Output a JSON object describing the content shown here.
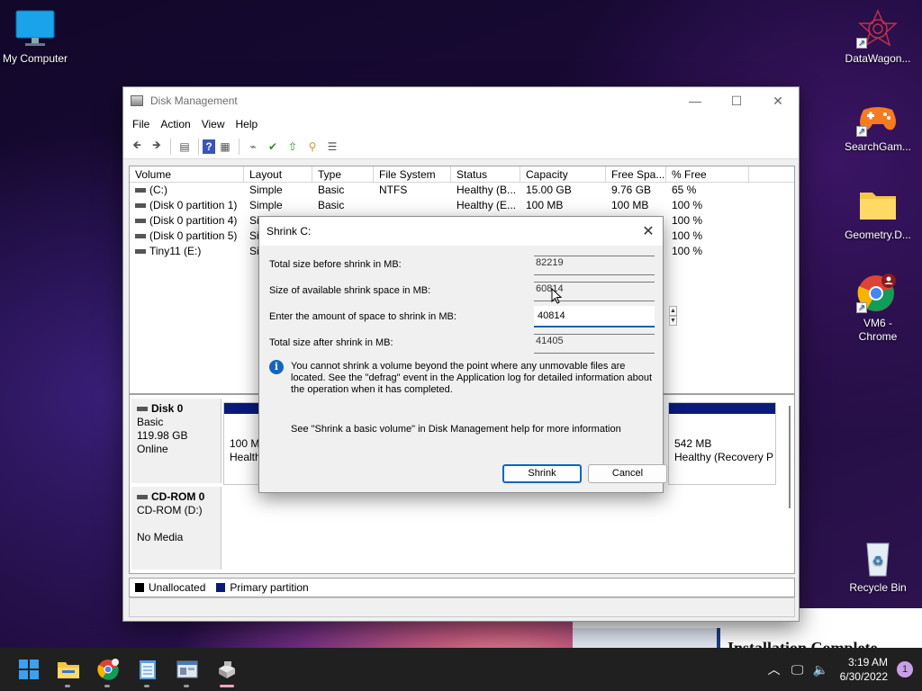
{
  "desktop": {
    "icons": [
      {
        "label": "My Computer"
      },
      {
        "label": "DataWagon..."
      },
      {
        "label": "SearchGam..."
      },
      {
        "label": "Geometry.D..."
      },
      {
        "label": "VM6 -\nChrome"
      },
      {
        "label": "Recycle Bin"
      }
    ]
  },
  "window": {
    "title": "Disk Management",
    "menu": [
      "File",
      "Action",
      "View",
      "Help"
    ],
    "columns": [
      "Volume",
      "Layout",
      "Type",
      "File System",
      "Status",
      "Capacity",
      "Free Spa...",
      "% Free"
    ],
    "volumes": [
      [
        "(C:)",
        "Simple",
        "Basic",
        "NTFS",
        "Healthy (B...",
        "15.00 GB",
        "9.76 GB",
        "65 %"
      ],
      [
        "(Disk 0 partition 1)",
        "Simple",
        "Basic",
        "",
        "Healthy (E...",
        "100 MB",
        "100 MB",
        "100 %"
      ],
      [
        "(Disk 0 partition 4)",
        "Si",
        "",
        "",
        "",
        "",
        "",
        "100 %"
      ],
      [
        "(Disk 0 partition 5)",
        "Si",
        "",
        "",
        "",
        "",
        "",
        "100 %"
      ],
      [
        "Tiny11 (E:)",
        "Si",
        "",
        "",
        "",
        "",
        "",
        "100 %"
      ]
    ],
    "disks": [
      {
        "name": "Disk 0",
        "type": "Basic",
        "size": "119.98 GB",
        "status": "Online"
      },
      {
        "name": "CD-ROM 0",
        "type": "CD-ROM (D:)",
        "size": "",
        "status": "No Media"
      }
    ],
    "partitions": [
      {
        "line1": "100 M",
        "line2": "Health"
      },
      {
        "line1": "542 MB",
        "line2": "Healthy (Recovery P"
      }
    ],
    "legend": [
      {
        "label": "Unallocated",
        "color": "#000000"
      },
      {
        "label": "Primary partition",
        "color": "#0a1a7a"
      }
    ]
  },
  "dialog": {
    "title": "Shrink C:",
    "fields": [
      {
        "label": "Total size before shrink in MB:",
        "value": "82219"
      },
      {
        "label": "Size of available shrink space in MB:",
        "value": "60814"
      },
      {
        "label": "Enter the amount of space to shrink in MB:",
        "value": "40814"
      },
      {
        "label": "Total size after shrink in MB:",
        "value": "41405"
      }
    ],
    "info": "You cannot shrink a volume beyond the point where any unmovable files are located. See the \"defrag\" event in the Application log for detailed information about the operation when it has completed.",
    "help": "See \"Shrink a basic volume\" in Disk Management help for more information",
    "shrink_label": "Shrink",
    "cancel_label": "Cancel"
  },
  "background_window": {
    "heading": "Installation Complete"
  },
  "taskbar": {
    "apps": [
      "start-icon",
      "file-explorer-icon",
      "chrome-icon",
      "notepad-icon",
      "control-panel-icon",
      "disk-management-icon"
    ],
    "time": "3:19 AM",
    "date": "6/30/2022",
    "notification_count": "1"
  }
}
